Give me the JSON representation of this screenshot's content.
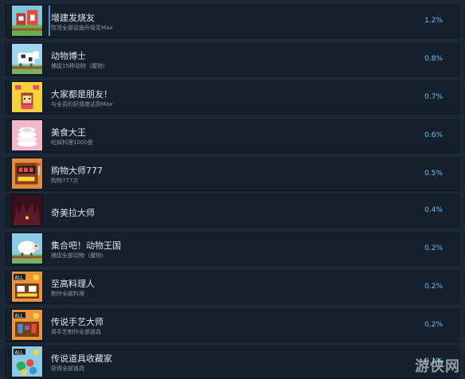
{
  "achievements": [
    {
      "title": "增建发烧友",
      "desc": "牧场全部设施升级至Max",
      "percent": "1.2%",
      "icon": "farm-buildings-icon",
      "bg": "#7ec8e0"
    },
    {
      "title": "动物博士",
      "desc": "捕捉15种动物（魔物）",
      "percent": "0.8%",
      "icon": "cow-icon",
      "bg": "#9fd4ee"
    },
    {
      "title": "大家都是朋友！",
      "desc": "与全员的好感度达到Max",
      "percent": "0.7%",
      "icon": "hearts-face-icon",
      "bg": "#f5d33a"
    },
    {
      "title": "美食大王",
      "desc": "吃掉料理1000盘",
      "percent": "0.6%",
      "icon": "plates-stack-icon",
      "bg": "#f2b8c8"
    },
    {
      "title": "购物大师777",
      "desc": "购物777次",
      "percent": "0.5%",
      "icon": "slot-machine-icon",
      "bg": "#e0903c"
    },
    {
      "title": "奇美拉大师",
      "desc": "",
      "percent": "0.4%",
      "icon": "chimera-icon",
      "bg": "#5c1a2a"
    },
    {
      "title": "集合吧！动物王国",
      "desc": "捕捉全部动物（魔物）",
      "percent": "0.2%",
      "icon": "sheep-icon",
      "bg": "#8ccbe8"
    },
    {
      "title": "至高料理人",
      "desc": "制作全部料理",
      "percent": "0.2%",
      "icon": "all-cooking-icon",
      "bg": "#e8963a"
    },
    {
      "title": "传说手艺大师",
      "desc": "用手艺制作全部道具",
      "percent": "0.2%",
      "icon": "all-crafting-icon",
      "bg": "#e8963a"
    },
    {
      "title": "传说道具收藏家",
      "desc": "获得全部道具",
      "percent": "0.1%",
      "icon": "all-items-icon",
      "bg": "#8ccbe8"
    }
  ],
  "watermark": "游侠网"
}
